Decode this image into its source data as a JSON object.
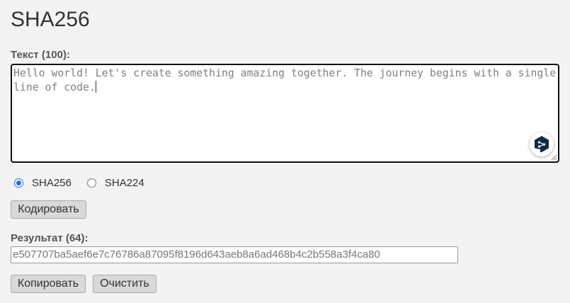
{
  "header": {
    "title": "SHA256"
  },
  "input": {
    "label": "Текст (100):",
    "value": "Hello world! Let's create something amazing together. The journey begins with a single line of code."
  },
  "algorithms": {
    "options": [
      {
        "label": "SHA256",
        "checked": true
      },
      {
        "label": "SHA224",
        "checked": false
      }
    ]
  },
  "actions": {
    "encode_label": "Кодировать",
    "copy_label": "Копировать",
    "clear_label": "Очистить"
  },
  "result": {
    "label": "Результат (64):",
    "value": "e507707ba5aef6e7c76786a87095f8196d643aeb8a6ad468b4c2b558a3f4ca80"
  },
  "icons": {
    "translate_badge": "deepl-icon",
    "resize": "resize-grip-icon"
  },
  "colors": {
    "accent": "#1a73e8",
    "badge": "#0f2b46",
    "background": "#f3f3f3"
  }
}
